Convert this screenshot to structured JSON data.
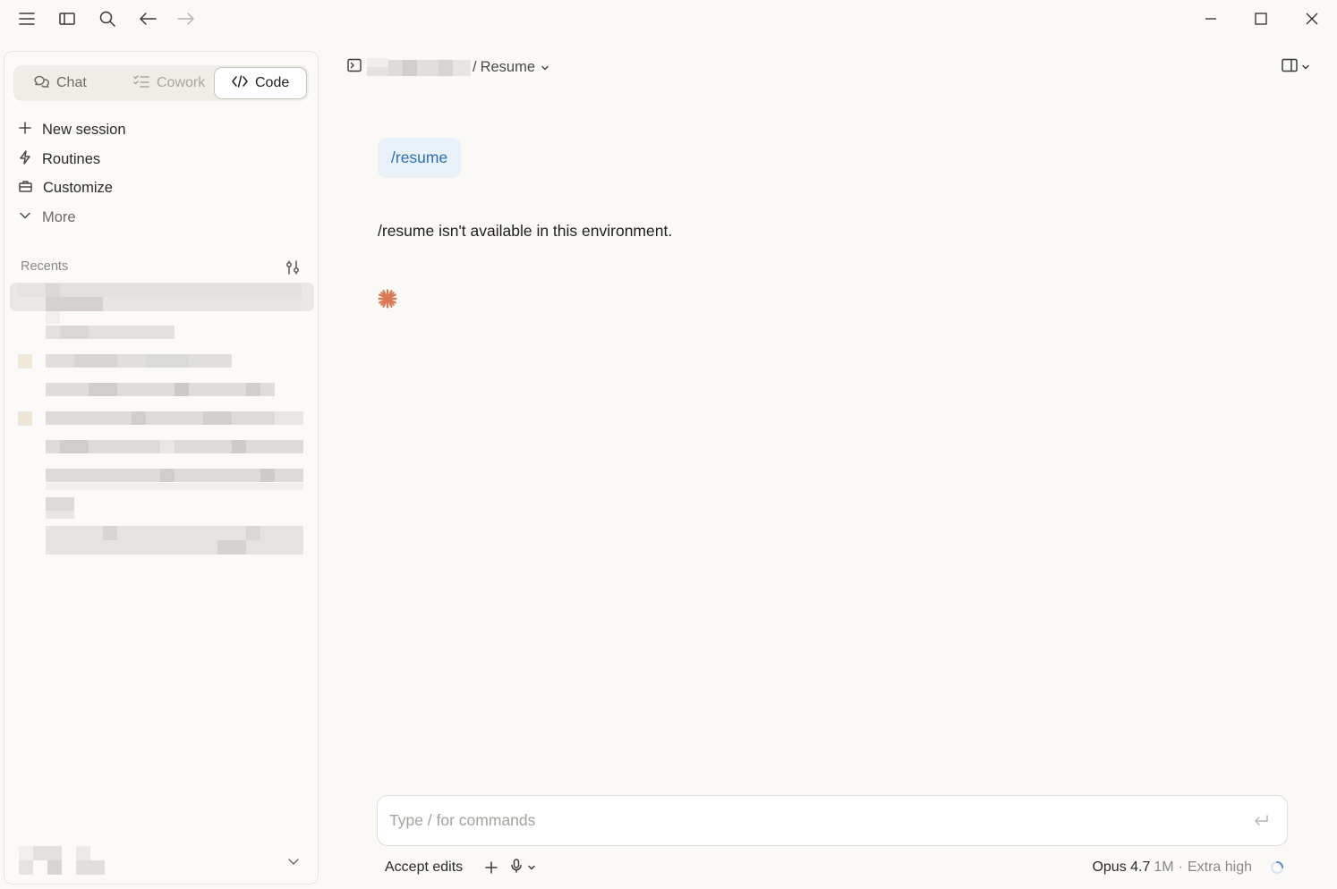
{
  "titlebar": {
    "icons": [
      "menu-icon",
      "sidebar-toggle-icon",
      "search-icon",
      "back-arrow-icon",
      "forward-arrow-icon"
    ],
    "window_controls": [
      "minimize-icon",
      "maximize-icon",
      "close-icon"
    ]
  },
  "sidebar": {
    "modes": [
      {
        "label": "Chat",
        "icon": "chat-bubbles-icon",
        "selected": false
      },
      {
        "label": "Cowork",
        "icon": "checklist-icon",
        "selected": false
      },
      {
        "label": "Code",
        "icon": "code-brackets-icon",
        "selected": true
      }
    ],
    "nav": [
      {
        "label": "New session",
        "icon": "plus-icon"
      },
      {
        "label": "Routines",
        "icon": "lightning-icon"
      },
      {
        "label": "Customize",
        "icon": "briefcase-icon"
      },
      {
        "label": "More",
        "icon": "chevron-down-icon"
      }
    ],
    "recents_label": "Recents"
  },
  "header": {
    "separator": "/",
    "session_title": "Resume"
  },
  "conversation": {
    "user_message": "/resume",
    "assistant_message": "/resume isn't available in this environment."
  },
  "composer": {
    "placeholder": "Type / for commands",
    "accept_edits_label": "Accept edits",
    "model_name": "Opus 4.7",
    "model_context": "1M",
    "model_separator": "·",
    "effort": "Extra high"
  },
  "colors": {
    "accent_blue": "#2c6fb3",
    "user_bubble": "#e8f0f8",
    "spark": "#d97757",
    "background": "#faf9f6"
  }
}
